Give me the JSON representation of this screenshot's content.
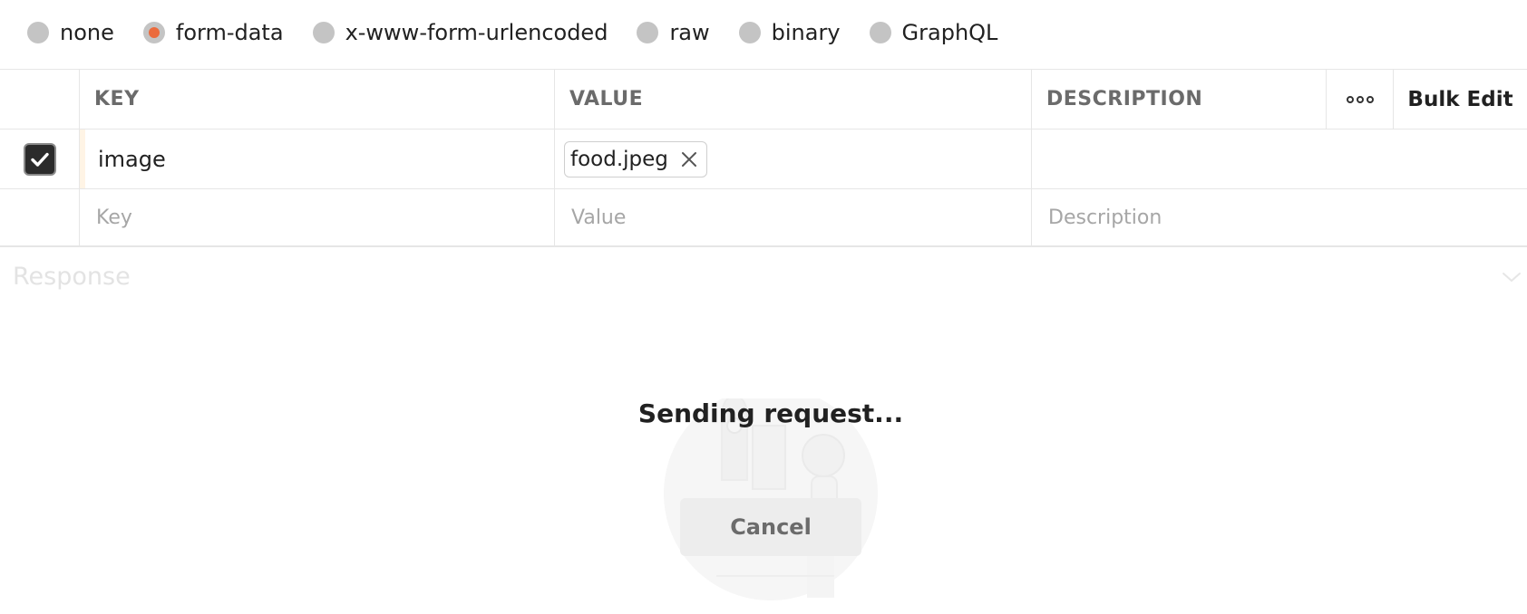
{
  "body_types": [
    {
      "label": "none",
      "selected": false
    },
    {
      "label": "form-data",
      "selected": true
    },
    {
      "label": "x-www-form-urlencoded",
      "selected": false
    },
    {
      "label": "raw",
      "selected": false
    },
    {
      "label": "binary",
      "selected": false
    },
    {
      "label": "GraphQL",
      "selected": false
    }
  ],
  "table": {
    "headers": {
      "key": "KEY",
      "value": "VALUE",
      "description": "DESCRIPTION"
    },
    "bulk_edit_label": "Bulk Edit",
    "more_icon": "more-horizontal-icon",
    "rows": [
      {
        "enabled": true,
        "key": "image",
        "value_file": "food.jpeg",
        "description": ""
      }
    ],
    "new_row": {
      "key_placeholder": "Key",
      "value_placeholder": "Value",
      "description_placeholder": "Description"
    }
  },
  "response": {
    "label": "Response",
    "status_text": "Sending request...",
    "cancel_label": "Cancel"
  },
  "colors": {
    "accent": "#eb6b3d",
    "radio_off": "#c4c4c4"
  }
}
